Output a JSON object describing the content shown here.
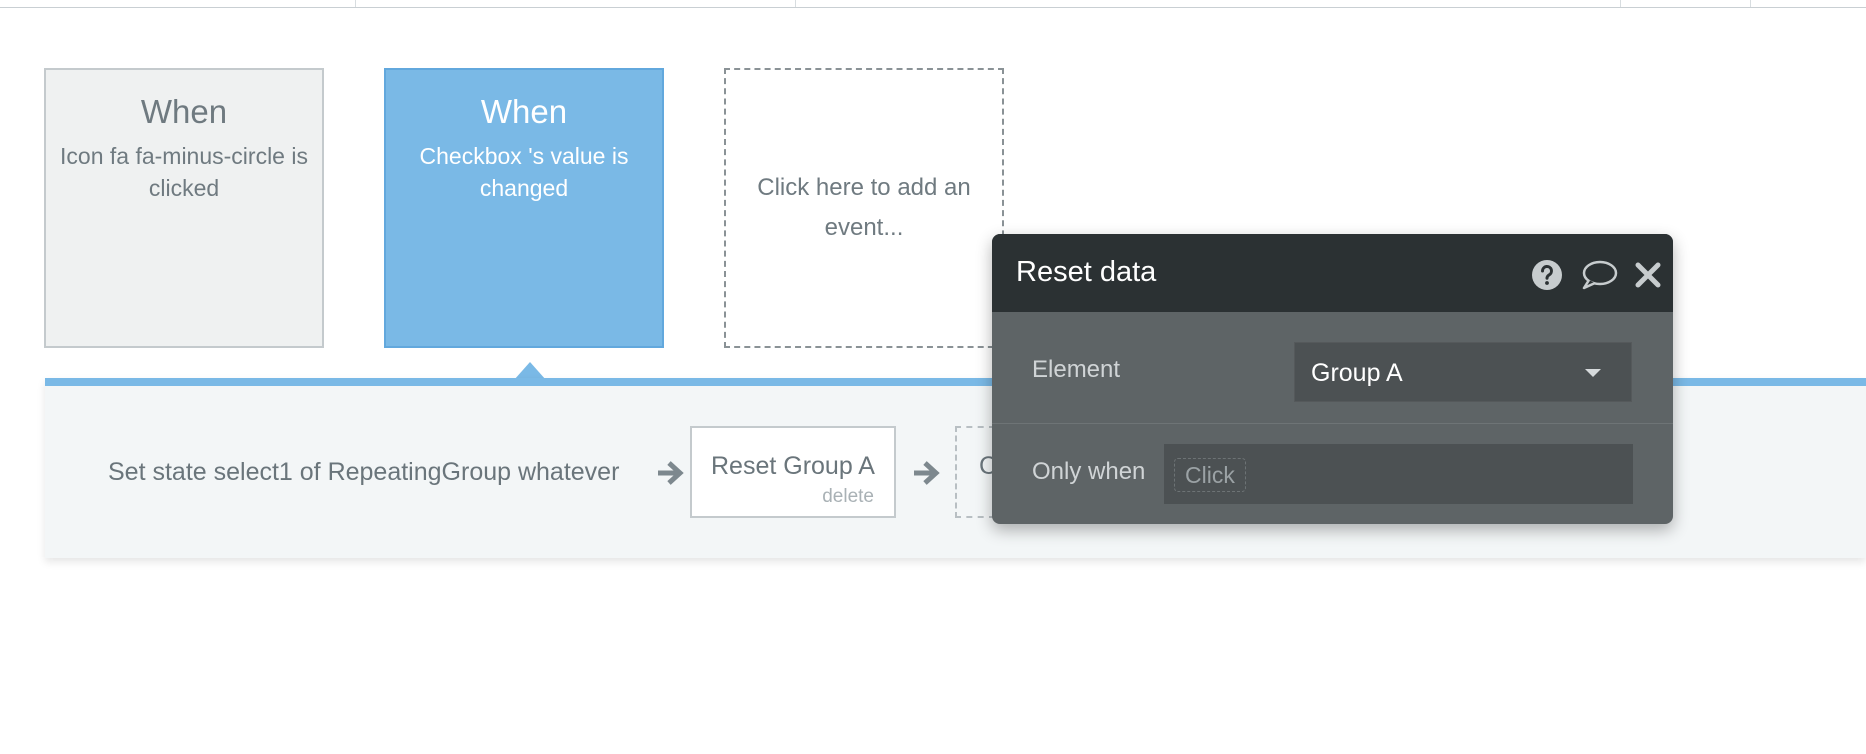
{
  "events": [
    {
      "when": "When",
      "description": "Icon fa fa-minus-circle is clicked",
      "selected": false
    },
    {
      "when": "When",
      "description": "Checkbox 's value is changed",
      "selected": true
    }
  ],
  "add_event": {
    "label": "Click here to add an event..."
  },
  "actions": {
    "step1_label": "Set state select1 of RepeatingGroup whatever",
    "step2_label": "Reset Group A",
    "step2_delete": "delete",
    "step3_label": "C"
  },
  "dialog": {
    "title": "Reset data",
    "element_label": "Element",
    "element_value": "Group A",
    "only_when_label": "Only when",
    "only_when_placeholder": "Click"
  },
  "icons": {
    "help": "question-circle-icon",
    "comment": "speech-bubble-icon",
    "close": "close-icon",
    "arrow": "arrow-right-icon",
    "dropdown": "caret-down-icon"
  },
  "colors": {
    "selected_card": "#7ab9e6",
    "dialog_header": "#2b3133",
    "dialog_body": "#5e6466",
    "action_strip": "#f3f6f7"
  }
}
